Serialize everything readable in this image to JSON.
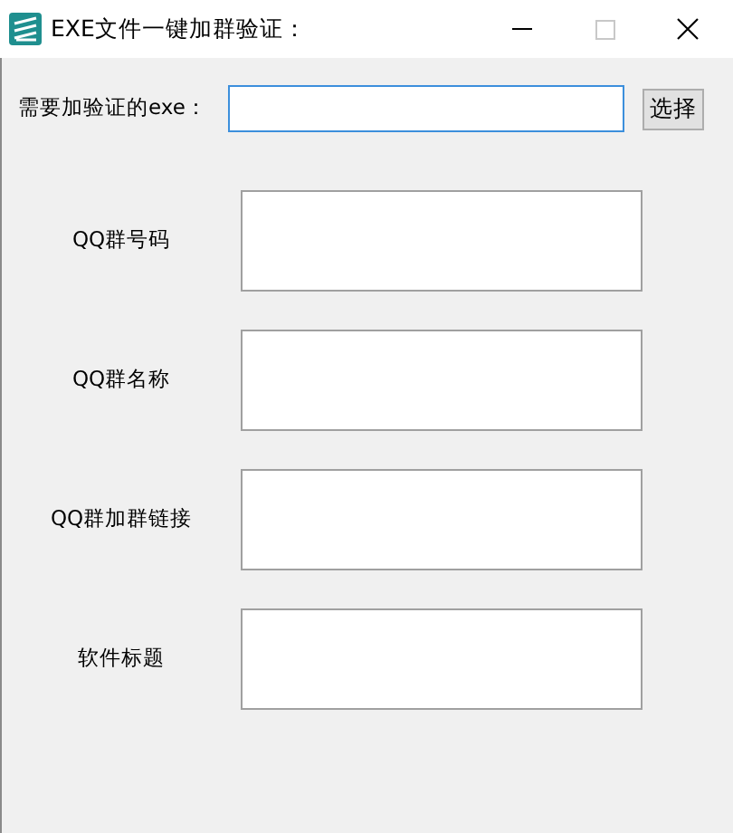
{
  "window": {
    "title": "EXE文件一键加群验证：",
    "maximize_disabled": true
  },
  "exe_row": {
    "label": "需要加验证的exe：",
    "focused": true,
    "button": "选择"
  },
  "fields": [
    {
      "label": "QQ群号码"
    },
    {
      "label": "QQ群名称"
    },
    {
      "label": "QQ群加群链接"
    },
    {
      "label": "软件标题"
    }
  ]
}
